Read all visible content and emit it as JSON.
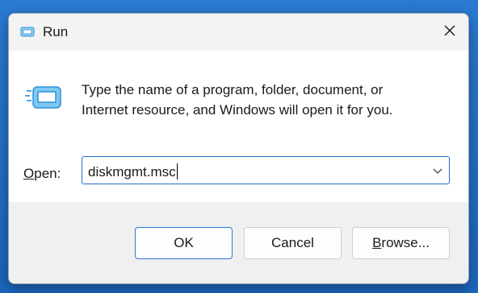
{
  "window": {
    "title": "Run",
    "title_icon": "run-icon",
    "close_icon": "close-icon"
  },
  "content": {
    "app_icon": "run-app-icon",
    "description_line1": "Type the name of a program, folder, document, or",
    "description_line2": "Internet resource, and Windows will open it for you.",
    "open_label_accel": "O",
    "open_label_rest": "pen:",
    "input_value": "diskmgmt.msc",
    "dropdown_icon": "chevron-down-icon"
  },
  "buttons": {
    "ok": "OK",
    "cancel": "Cancel",
    "browse_accel": "B",
    "browse_rest": "rowse..."
  },
  "colors": {
    "desktop": "#1d66bd",
    "accent": "#1e72c4",
    "dialog_bg": "#f3f3f3",
    "content_bg": "#ffffff"
  }
}
